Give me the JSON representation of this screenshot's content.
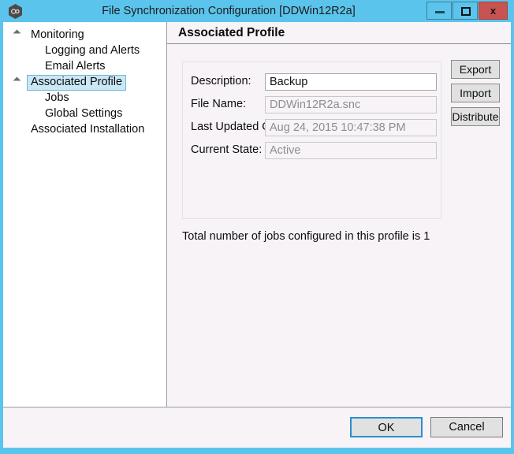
{
  "window": {
    "title": "File Synchronization Configuration [DDWin12R2a]",
    "icon": "app-hexagon-icon",
    "accent_color": "#5bc4ec",
    "close_color": "#c75450",
    "controls": {
      "minimize": "minimize-icon",
      "maximize": "maximize-icon",
      "close_label": "x"
    }
  },
  "sidebar": {
    "items": [
      {
        "label": "Monitoring",
        "level": 0,
        "expander": true,
        "selected": false
      },
      {
        "label": "Logging and Alerts",
        "level": 1,
        "expander": false,
        "selected": false
      },
      {
        "label": "Email Alerts",
        "level": 1,
        "expander": false,
        "selected": false
      },
      {
        "label": "Associated Profile",
        "level": 0,
        "expander": true,
        "selected": true
      },
      {
        "label": "Jobs",
        "level": 1,
        "expander": false,
        "selected": false
      },
      {
        "label": "Global Settings",
        "level": 1,
        "expander": false,
        "selected": false
      },
      {
        "label": "Associated Installation",
        "level": 0,
        "expander": false,
        "selected": false
      }
    ]
  },
  "content": {
    "header": "Associated Profile",
    "fields": [
      {
        "label": "Description:",
        "value": "Backup",
        "disabled": false
      },
      {
        "label": "File Name:",
        "value": "DDWin12R2a.snc",
        "disabled": true
      },
      {
        "label": "Last Updated On:",
        "value": "Aug 24, 2015 10:47:38 PM",
        "disabled": true
      },
      {
        "label": "Current State:",
        "value": "Active",
        "disabled": true
      }
    ],
    "side_buttons": [
      {
        "label": "Export"
      },
      {
        "label": "Import"
      },
      {
        "label": "Distribute"
      }
    ],
    "jobs_text": "Total number of jobs configured in this profile is 1"
  },
  "footer": {
    "ok_label": "OK",
    "cancel_label": "Cancel"
  }
}
